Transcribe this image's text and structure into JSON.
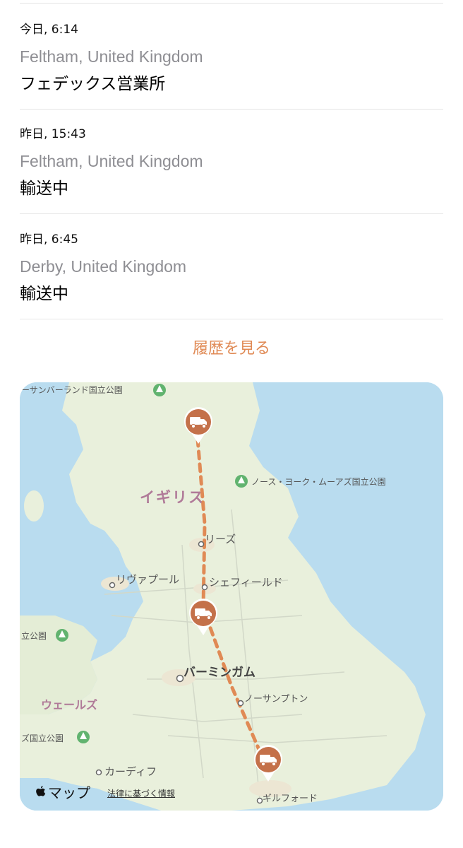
{
  "events": [
    {
      "time": "今日, 6:14",
      "location": "Feltham, United Kingdom",
      "status": "フェデックス営業所"
    },
    {
      "time": "昨日, 15:43",
      "location": "Feltham, United Kingdom",
      "status": "輸送中"
    },
    {
      "time": "昨日, 6:45",
      "location": "Derby, United Kingdom",
      "status": "輸送中"
    }
  ],
  "history_button": "履歴を見る",
  "map": {
    "labels": {
      "northumberland": "ーサンバーランド国立公園",
      "north_york": "ノース・ヨーク・ムーアズ国立公園",
      "uk": "イギリス",
      "leeds": "リーズ",
      "liverpool": "リヴァプール",
      "sheffield": "シェフィールド",
      "snowdonia": "立公園",
      "birmingham": "バーミンガム",
      "northampton": "ノーサンプトン",
      "wales": "ウェールズ",
      "brecon": "ズ国立公園",
      "cardiff": "カーディフ",
      "guildford": "ギルフォード"
    },
    "brand": "マップ",
    "legal": "法律に基づく情報",
    "colors": {
      "route": "#e08a55",
      "pin": "#c4714a",
      "water": "#b9dcef",
      "land": "#e9f0dc",
      "park": "#61b36f"
    }
  }
}
